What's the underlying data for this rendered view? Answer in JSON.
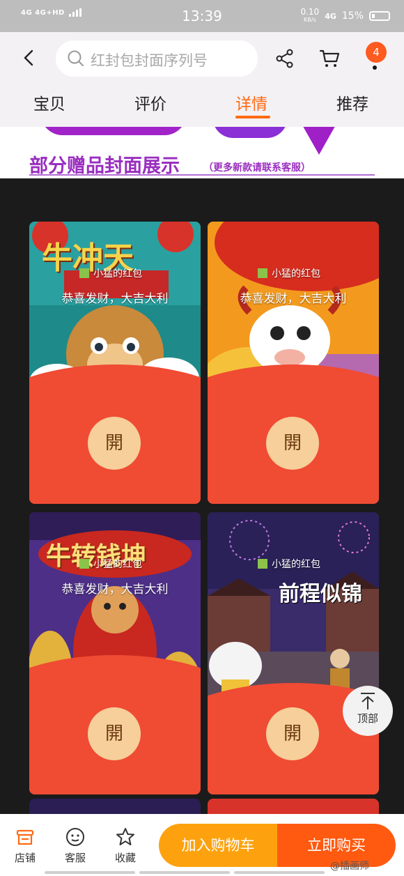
{
  "status_bar": {
    "network_left": "4G  4G+HD",
    "time": "13:39",
    "speed": "0.10",
    "speed_unit": "KB/s",
    "network_right": "4G",
    "battery": "15%"
  },
  "header": {
    "search_placeholder": "红封包封面序列号",
    "cart_count": "4"
  },
  "tabs": [
    {
      "label": "宝贝"
    },
    {
      "label": "评价"
    },
    {
      "label": "详情"
    },
    {
      "label": "推荐"
    }
  ],
  "active_tab": "详情",
  "banner": {
    "title": "部分赠品封面展示",
    "subtitle": "（更多新款请联系客服）"
  },
  "cards": [
    {
      "brand": "小猛的红包",
      "greeting": "恭喜发财，大吉大利",
      "open_label": "開",
      "art_title": "牛冲天"
    },
    {
      "brand": "小猛的红包",
      "greeting": "恭喜发财，大吉大利",
      "open_label": "開",
      "art_title": ""
    },
    {
      "brand": "小猛的红包",
      "greeting": "恭喜发财，大吉大利",
      "open_label": "開",
      "art_title": "牛转钱坤"
    },
    {
      "brand": "小猛的红包",
      "greeting": "",
      "open_label": "開",
      "art_title": "前程似锦"
    }
  ],
  "back_to_top": "顶部",
  "bottom_bar": {
    "shop": "店铺",
    "service": "客服",
    "favorite": "收藏",
    "add_to_cart": "加入购物车",
    "buy_now": "立即购买"
  },
  "watermark": "@插画师"
}
